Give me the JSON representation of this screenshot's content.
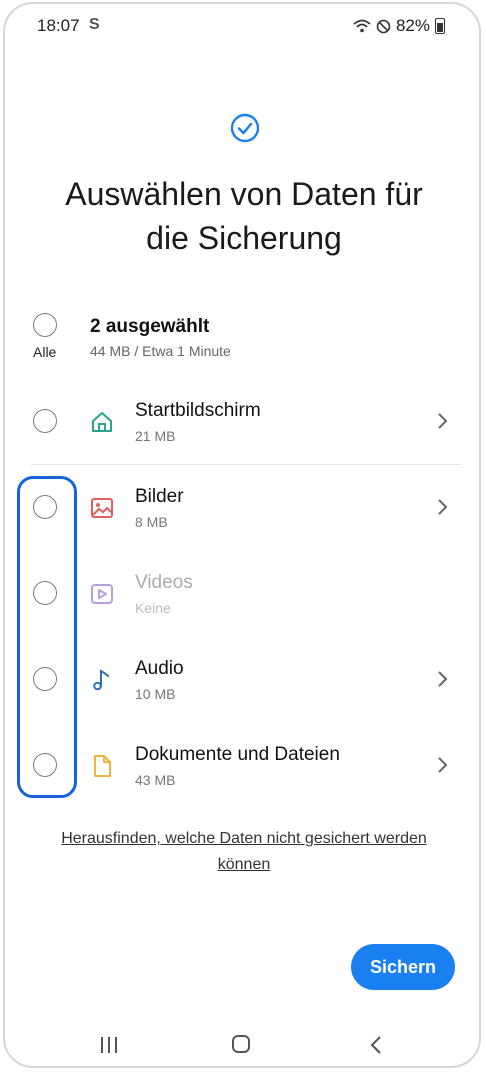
{
  "status_bar": {
    "time": "18:07",
    "app_indicator": "S",
    "battery": "82%"
  },
  "header": {
    "title_line1": "Auswählen von Daten für",
    "title_line2": "die Sicherung"
  },
  "summary": {
    "all_label": "Alle",
    "selected": "2 ausgewählt",
    "details": "44 MB / Etwa 1 Minute"
  },
  "items": [
    {
      "title": "Startbildschirm",
      "subtitle": "21 MB",
      "icon": "home-icon",
      "color": "#2aa38a",
      "enabled": true
    },
    {
      "title": "Bilder",
      "subtitle": "8 MB",
      "icon": "image-icon",
      "color": "#e0605f",
      "enabled": true
    },
    {
      "title": "Videos",
      "subtitle": "Keine",
      "icon": "video-icon",
      "color": "#b89ed8",
      "enabled": false
    },
    {
      "title": "Audio",
      "subtitle": "10 MB",
      "icon": "music-note-icon",
      "color": "#2a6fb8",
      "enabled": true
    },
    {
      "title": "Dokumente und Dateien",
      "subtitle": "43 MB",
      "icon": "document-icon",
      "color": "#f2b340",
      "enabled": true
    }
  ],
  "footer": {
    "link_line1": "Herausfinden, welche Daten nicht gesichert werden",
    "link_line2": "können",
    "button": "Sichern"
  },
  "colors": {
    "accent": "#1a7ff0",
    "highlight": "#1565d8"
  }
}
